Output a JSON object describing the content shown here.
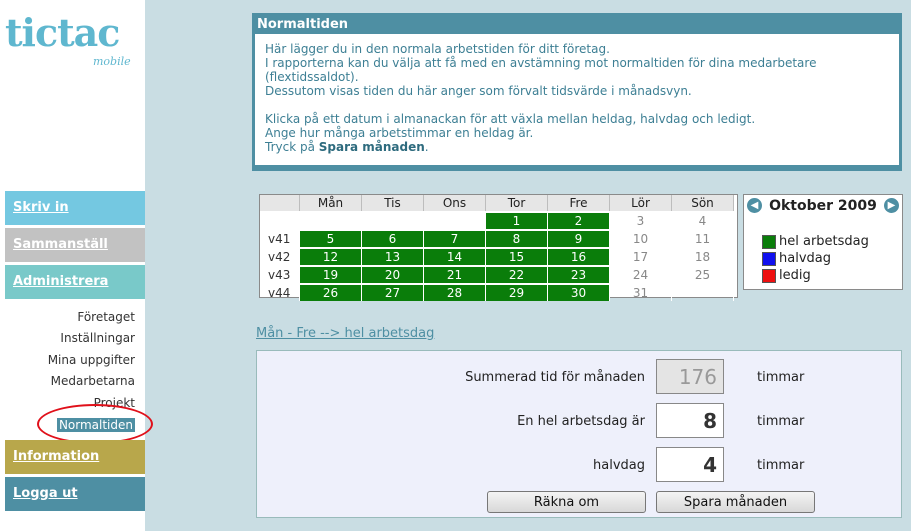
{
  "logo": {
    "text": "tictac",
    "sub": "mobile"
  },
  "nav": {
    "skriv": "Skriv in",
    "samman": "Sammanställ",
    "admin": "Administrera",
    "info": "Information",
    "logga": "Logga ut"
  },
  "subnav": [
    "Företaget",
    "Inställningar",
    "Mina uppgifter",
    "Medarbetarna",
    "Projekt",
    "Normaltiden"
  ],
  "info": {
    "title": "Normaltiden",
    "p1_l1": "Här lägger du in den normala arbetstiden för ditt företag.",
    "p1_l2": "I rapporterna kan du välja att få med en avstämning mot normaltiden för dina medarbetare",
    "p1_l3": "(flextidssaldot).",
    "p1_l4": "Dessutom visas tiden du här anger som förvalt tidsvärde i månadsvyn.",
    "p2_l1": "Klicka på ett datum i almanackan för att växla mellan heldag, halvdag och ledigt.",
    "p2_l2": "Ange hur många arbetstimmar en heldag är.",
    "p2_l3_pre": "Tryck på ",
    "p2_l3_bold": "Spara månaden",
    "p2_l3_post": "."
  },
  "calendar": {
    "days": [
      "Mån",
      "Tis",
      "Ons",
      "Tor",
      "Fre",
      "Lör",
      "Sön"
    ],
    "rows": [
      {
        "week": "",
        "cells": [
          "",
          "",
          "",
          "1",
          "2",
          "3",
          "4"
        ]
      },
      {
        "week": "v41",
        "cells": [
          "5",
          "6",
          "7",
          "8",
          "9",
          "10",
          "11"
        ]
      },
      {
        "week": "v42",
        "cells": [
          "12",
          "13",
          "14",
          "15",
          "16",
          "17",
          "18"
        ]
      },
      {
        "week": "v43",
        "cells": [
          "19",
          "20",
          "21",
          "22",
          "23",
          "24",
          "25"
        ]
      },
      {
        "week": "v44",
        "cells": [
          "26",
          "27",
          "28",
          "29",
          "30",
          "31",
          ""
        ]
      }
    ]
  },
  "month": {
    "title": "Oktober 2009",
    "legend": [
      {
        "label": "hel arbetsdag",
        "color": "#0a7d0a"
      },
      {
        "label": "halvdag",
        "color": "#1010ee"
      },
      {
        "label": "ledig",
        "color": "#ee1010"
      }
    ]
  },
  "link_text": "Mån - Fre --> hel arbetsdag",
  "form": {
    "sum_label": "Summerad tid för månaden",
    "sum_value": "176",
    "sum_unit": "timmar",
    "day_label": "En hel arbetsdag är",
    "day_value": "8",
    "day_unit": "timmar",
    "half_label": "halvdag",
    "half_value": "4",
    "half_unit": "timmar",
    "calc_btn": "Räkna om",
    "save_btn": "Spara månaden"
  }
}
